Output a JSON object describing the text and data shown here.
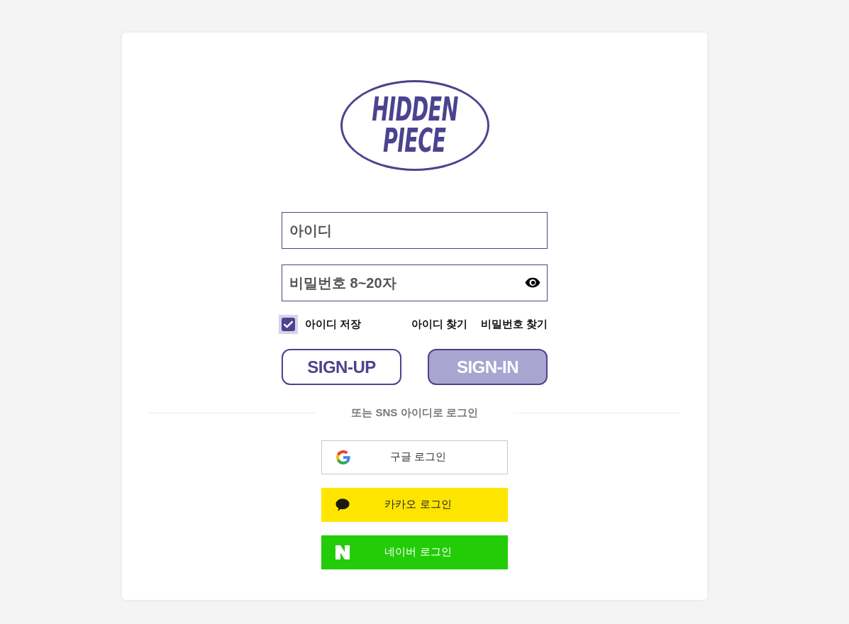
{
  "logo": {
    "lines": [
      "HIDDEN",
      "PIECE"
    ]
  },
  "id_field": {
    "placeholder": "아이디"
  },
  "password_field": {
    "placeholder": "비밀번호 8~20자"
  },
  "remember_id": {
    "label": "아이디 저장",
    "checked": true
  },
  "links": [
    "아이디 찾기",
    "비밀번호 찾기"
  ],
  "buttons": [
    {
      "kind": "outline",
      "label": "SIGN-UP"
    },
    {
      "kind": "filled",
      "label": "SIGN-IN"
    }
  ],
  "divider": {
    "text": "또는 SNS 아이디로 로그인"
  },
  "sns_buttons": [
    {
      "kind": "google",
      "label": "구글 로그인"
    },
    {
      "kind": "kakao",
      "label": "카카오 로그인"
    },
    {
      "kind": "naver",
      "label": "네이버 로그인"
    }
  ]
}
